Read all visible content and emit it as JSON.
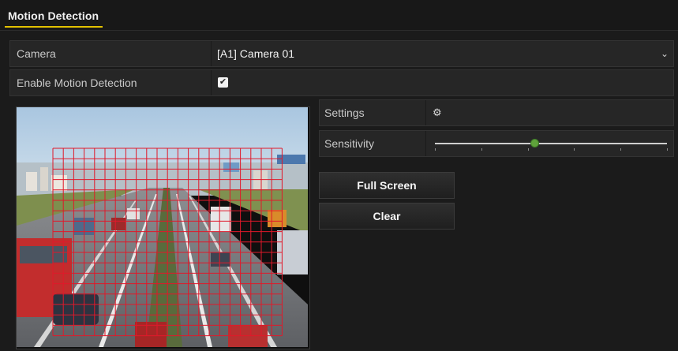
{
  "tab": {
    "label": "Motion Detection"
  },
  "camera": {
    "label": "Camera",
    "value": "[A1] Camera 01"
  },
  "enable": {
    "label": "Enable Motion Detection",
    "checked": true
  },
  "settings": {
    "label": "Settings"
  },
  "sensitivity": {
    "label": "Sensitivity",
    "value": 0.43,
    "ticks": 6
  },
  "buttons": {
    "full_screen": "Full Screen",
    "clear": "Clear"
  },
  "motion_grid": {
    "columns": 22,
    "rows": 18,
    "color": "#e0192a"
  },
  "colors": {
    "accent": "#e2c200",
    "slider_knob": "#5fa23b"
  }
}
